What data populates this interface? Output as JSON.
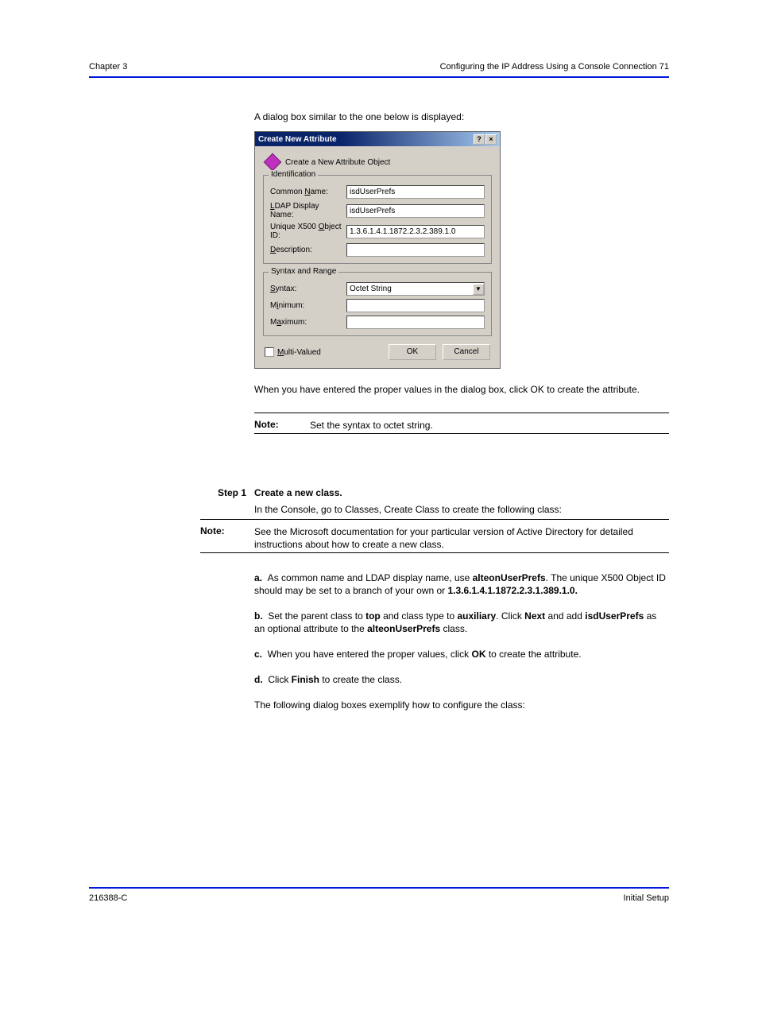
{
  "header": {
    "left": "Chapter 3",
    "right": "Configuring the IP Address Using a Console Connection   71"
  },
  "intro": "A dialog box similar to the one below is displayed:",
  "dialog": {
    "title": "Create New Attribute",
    "subheading": "Create a New Attribute Object",
    "group1_legend": "Identification",
    "group2_legend": "Syntax and Range",
    "fields": {
      "common_name": {
        "label": "Common Name:",
        "value": "isdUserPrefs",
        "u": "N"
      },
      "ldap_name": {
        "label": "LDAP Display Name:",
        "value": "isdUserPrefs",
        "u": "L"
      },
      "oid": {
        "label": "Unique X500 Object ID:",
        "value": "1.3.6.1.4.1.1872.2.3.2.389.1.0",
        "u": "O"
      },
      "description": {
        "label": "Description:",
        "value": "",
        "u": "D"
      },
      "syntax": {
        "label": "Syntax:",
        "value": "Octet String",
        "u": "S"
      },
      "minimum": {
        "label": "Minimum:",
        "value": "",
        "u": "i"
      },
      "maximum": {
        "label": "Maximum:",
        "value": "",
        "u": "a"
      }
    },
    "multi_valued": {
      "label": "Multi-Valued",
      "u": "M",
      "checked": false
    },
    "ok": "OK",
    "cancel": "Cancel"
  },
  "after_dialog": "When you have entered the proper values in the dialog box, click OK to create the attribute.",
  "note1": {
    "label": "Note:",
    "text": "Set the syntax to octet string."
  },
  "step1": {
    "num": "Step 1",
    "head": "Create a new class.",
    "body": "In the Console, go to Classes, Create Class to create the following class:"
  },
  "note2": {
    "label": "Note:",
    "text": "See the Microsoft documentation for your particular version of Active Directory for detailed instructions about how to create a new class."
  },
  "lettered": [
    {
      "k": "a.",
      "txt": "As common name and LDAP display name, use <b>alteonUserPrefs</b>. The unique X500 Object ID should may be set to a branch of your own or <b>1.3.6.1.4.1.1872.2.3.1.389.1.0.</b>"
    },
    {
      "k": "b.",
      "txt": "Set the parent class to <b>top</b> and class type to <b>auxiliary</b>. Click <b>Next</b> and add <b>isdUserPrefs</b> as an optional attribute to the <b>alteonUserPrefs</b> class."
    },
    {
      "k": "c.",
      "txt": "When you have entered the proper values, click <b>OK</b> to create the attribute."
    },
    {
      "k": "d.",
      "txt": "Click <b>Finish</b> to create the class."
    }
  ],
  "closing": "The following dialog boxes exemplify how to configure the class:",
  "footer": {
    "left": "216388-C",
    "right": "Initial Setup"
  }
}
